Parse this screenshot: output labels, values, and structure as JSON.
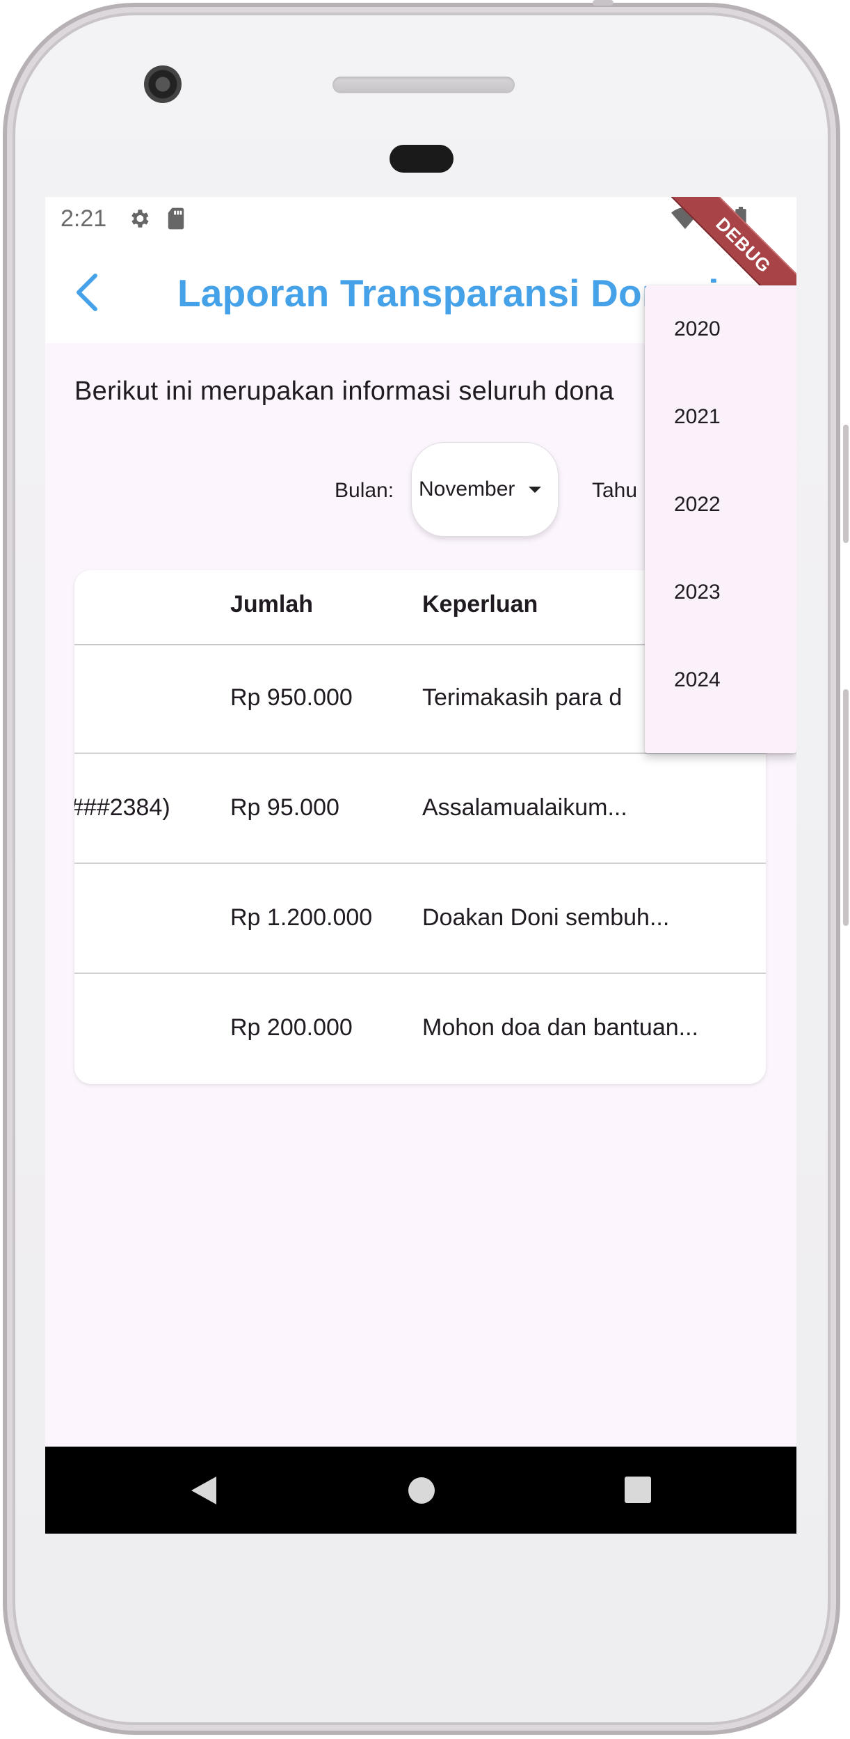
{
  "status_bar": {
    "time": "2:21",
    "left_icons": [
      "settings-icon",
      "sd-card-icon"
    ],
    "right_icons": [
      "wifi-icon",
      "cell-signal-icon",
      "battery-icon"
    ]
  },
  "app_bar": {
    "title": "Laporan Transparansi Donasi",
    "back_icon": "back-arrow-icon",
    "debug_banner": "DEBUG"
  },
  "intro_text": "Berikut ini merupakan informasi seluruh dona",
  "filters": {
    "month_label": "Bulan:",
    "month_value": "November",
    "year_label": "Tahu"
  },
  "table": {
    "headers": [
      "Jumlah",
      "Keperluan"
    ],
    "rows": [
      {
        "donor": "",
        "amount": "Rp 950.000",
        "purpose": "Terimakasih para d"
      },
      {
        "donor": "###2384)",
        "amount": "Rp 95.000",
        "purpose": "Assalamualaikum..."
      },
      {
        "donor": "",
        "amount": "Rp 1.200.000",
        "purpose": "Doakan Doni sembuh..."
      },
      {
        "donor": "",
        "amount": "Rp 200.000",
        "purpose": "Mohon doa dan bantuan..."
      }
    ]
  },
  "year_menu": {
    "options": [
      "2020",
      "2021",
      "2022",
      "2023",
      "2024"
    ]
  },
  "nav_bar": {
    "icons": [
      "back-triangle-icon",
      "home-circle-icon",
      "recents-square-icon"
    ]
  },
  "colors": {
    "accent": "#46a2e8",
    "background": "#fcf5fd",
    "menu_background": "#faf1fa",
    "debug_banner": "#a84447"
  }
}
